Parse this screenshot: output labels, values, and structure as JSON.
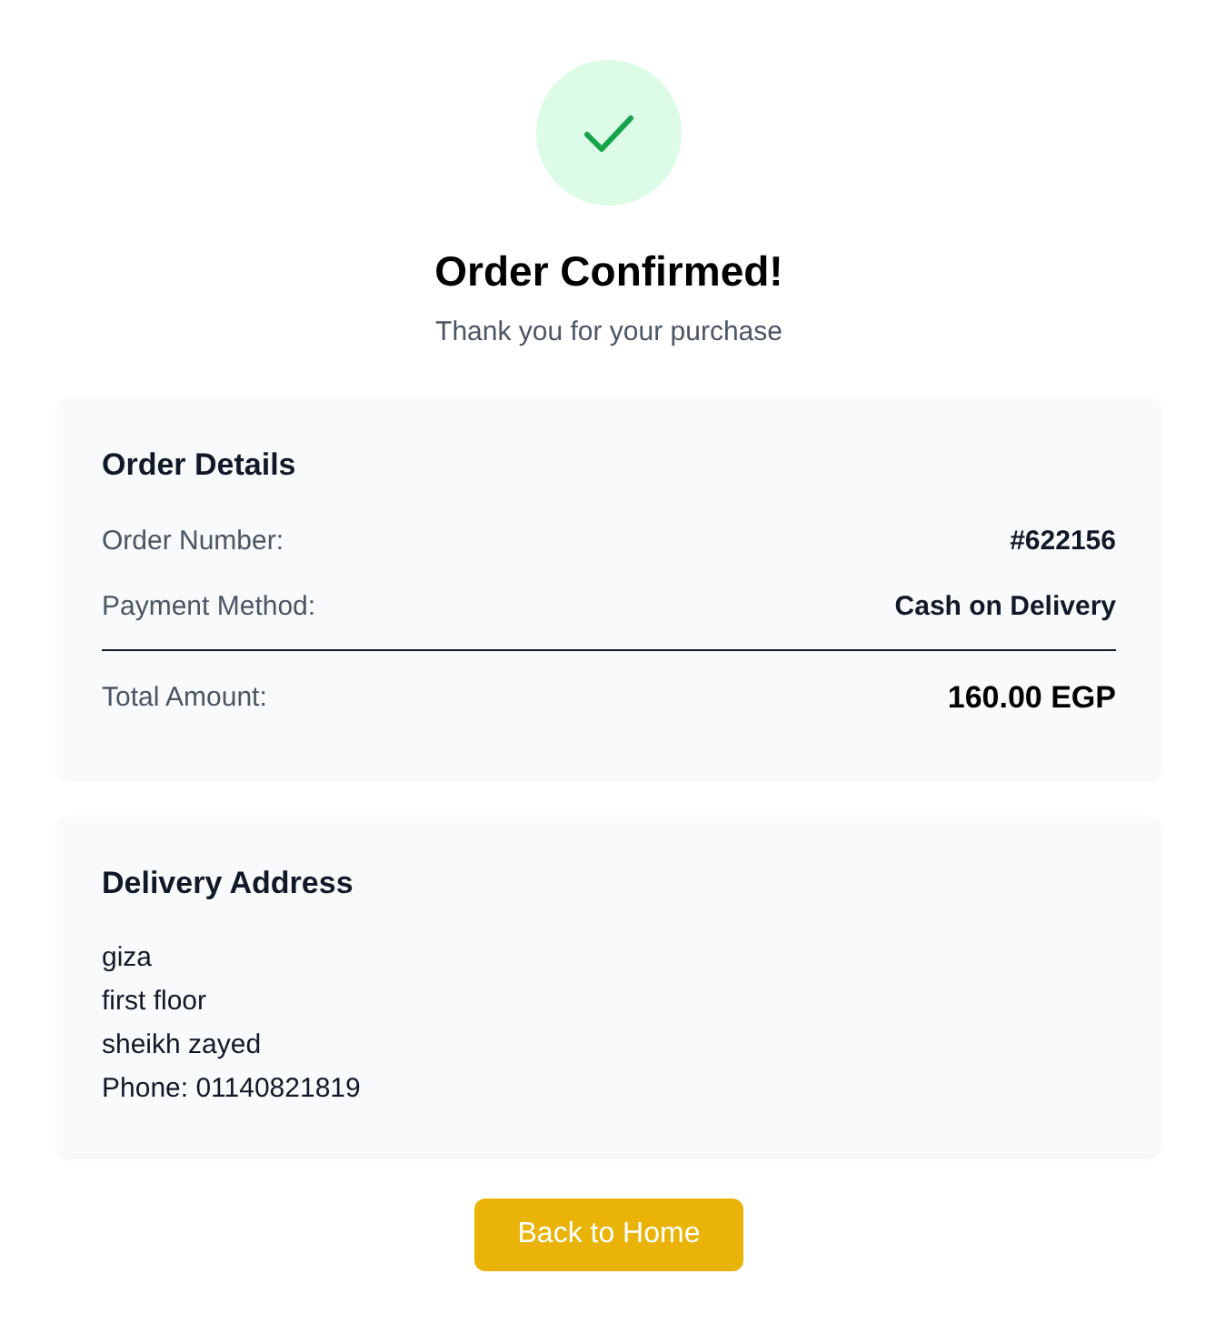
{
  "header": {
    "title": "Order Confirmed!",
    "subtitle": "Thank you for your purchase"
  },
  "order_details": {
    "title": "Order Details",
    "rows": [
      {
        "kind": "plain",
        "label": "Order Number:",
        "value": "#622156"
      },
      {
        "kind": "plain",
        "label": "Payment Method:",
        "value": "Cash on Delivery"
      },
      {
        "kind": "total",
        "label": "Total Amount:",
        "value": "160.00 EGP"
      }
    ]
  },
  "delivery_address": {
    "title": "Delivery Address",
    "lines": [
      "giza",
      "first floor",
      "sheikh zayed",
      "Phone: 01140821819"
    ]
  },
  "button": {
    "label": "Back to Home"
  }
}
